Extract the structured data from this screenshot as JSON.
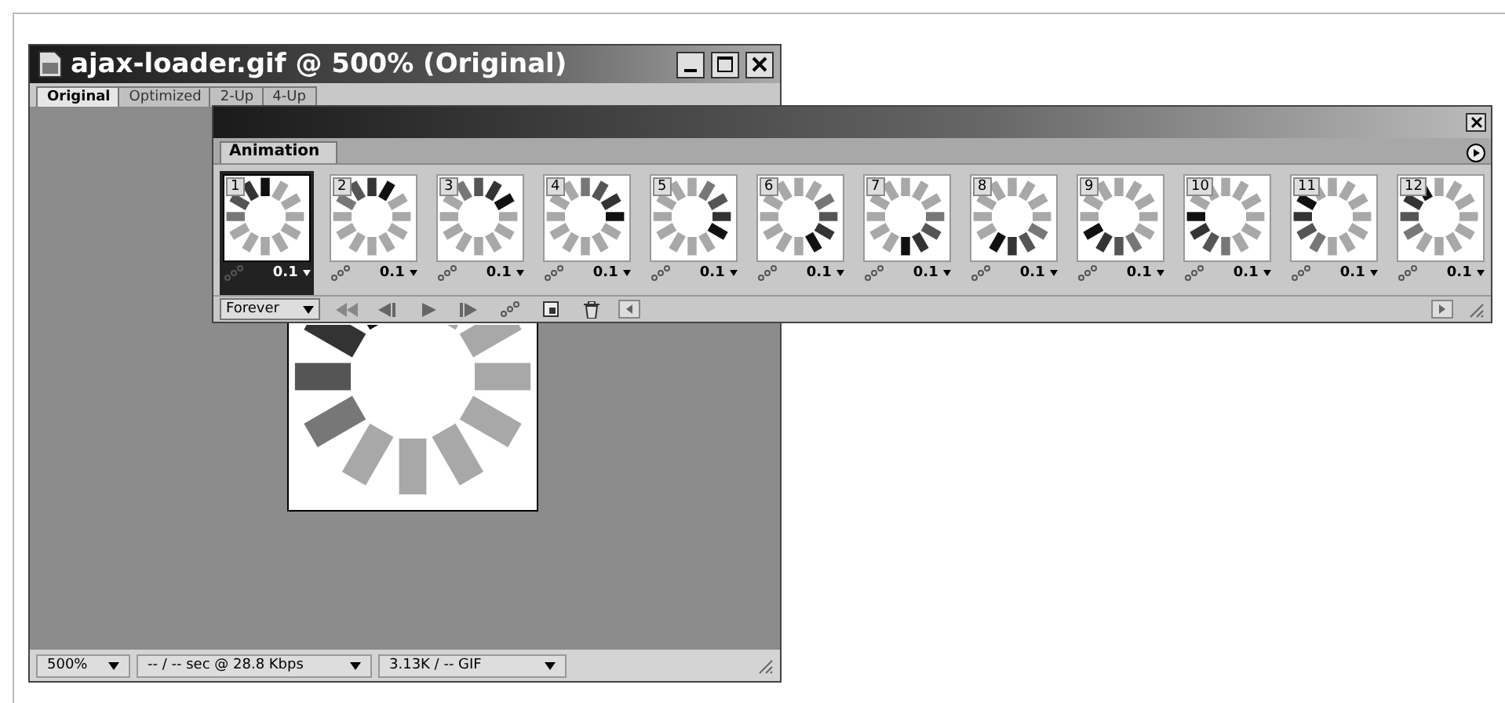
{
  "document": {
    "title": "ajax-loader.gif @ 500% (Original)",
    "tabs": [
      {
        "label": "Original",
        "selected": true
      },
      {
        "label": "Optimized",
        "selected": false
      },
      {
        "label": "2-Up",
        "selected": false
      },
      {
        "label": "4-Up",
        "selected": false
      }
    ],
    "status_bar": {
      "zoom": "500%",
      "download_time": "-- / -- sec @ 28.8 Kbps",
      "file_size": "3.13K / -- GIF"
    }
  },
  "animation_palette": {
    "tab": "Animation",
    "frames": [
      {
        "number": "1",
        "delay": "0.1",
        "selected": true
      },
      {
        "number": "2",
        "delay": "0.1",
        "selected": false
      },
      {
        "number": "3",
        "delay": "0.1",
        "selected": false
      },
      {
        "number": "4",
        "delay": "0.1",
        "selected": false
      },
      {
        "number": "5",
        "delay": "0.1",
        "selected": false
      },
      {
        "number": "6",
        "delay": "0.1",
        "selected": false
      },
      {
        "number": "7",
        "delay": "0.1",
        "selected": false
      },
      {
        "number": "8",
        "delay": "0.1",
        "selected": false
      },
      {
        "number": "9",
        "delay": "0.1",
        "selected": false
      },
      {
        "number": "10",
        "delay": "0.1",
        "selected": false
      },
      {
        "number": "11",
        "delay": "0.1",
        "selected": false
      },
      {
        "number": "12",
        "delay": "0.1",
        "selected": false
      }
    ],
    "loop": "Forever"
  }
}
